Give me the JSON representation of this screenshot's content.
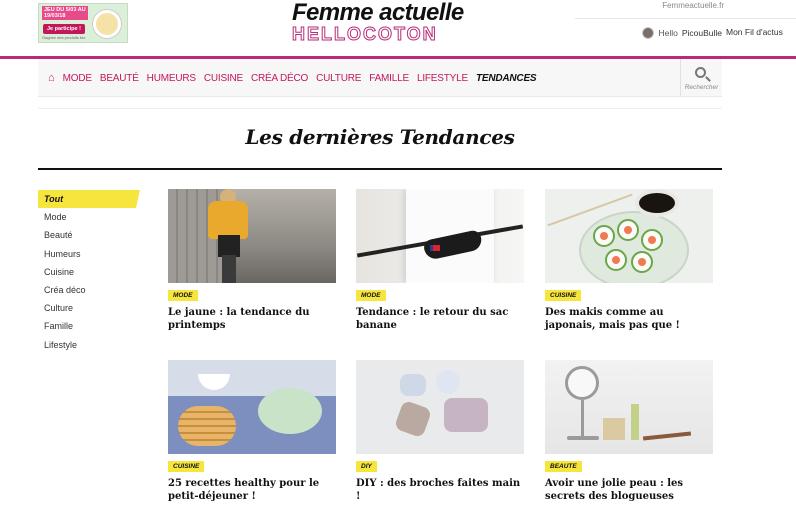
{
  "promo": {
    "line1": "Jeu du 5/03 au 19/03/18",
    "button": "Je participe !",
    "small": "Gagnez des produits bio"
  },
  "header": {
    "logo_line1": "Femme actuelle",
    "logo_line2": "HELLOCOTON",
    "site_link": "Femmeactuelle.fr",
    "hello": "Hello",
    "username": "PicouBulle",
    "my_feed": "Mon Fil d'actus"
  },
  "nav": {
    "items": [
      "MODE",
      "BEAUTÉ",
      "HUMEURS",
      "CUISINE",
      "CRÉA DÉCO",
      "CULTURE",
      "FAMILLE",
      "LIFESTYLE",
      "TENDANCES"
    ],
    "active": "TENDANCES",
    "search_label": "Rechercher",
    "accent": "#c2185b"
  },
  "page_title": "Les dernières Tendances",
  "sidebar": {
    "items": [
      "Tout",
      "Mode",
      "Beauté",
      "Humeurs",
      "Cuisine",
      "Créa déco",
      "Culture",
      "Famille",
      "Lifestyle"
    ],
    "active": "Tout"
  },
  "articles": [
    {
      "tag": "MODE",
      "title": "Le jaune : la tendance du printemps"
    },
    {
      "tag": "MODE",
      "title": "Tendance : le retour du sac banane"
    },
    {
      "tag": "CUISINE",
      "title": "Des makis comme au japonais, mais pas que !"
    },
    {
      "tag": "CUISINE",
      "title": "25 recettes healthy pour le petit-déjeuner !"
    },
    {
      "tag": "DIY",
      "title": "DIY : des broches faites main !"
    },
    {
      "tag": "BEAUTE",
      "title": "Avoir une jolie peau : les secrets des blogueuses"
    }
  ],
  "colors": {
    "brand": "#b72b7a",
    "tag_yellow": "#f5e53c"
  }
}
